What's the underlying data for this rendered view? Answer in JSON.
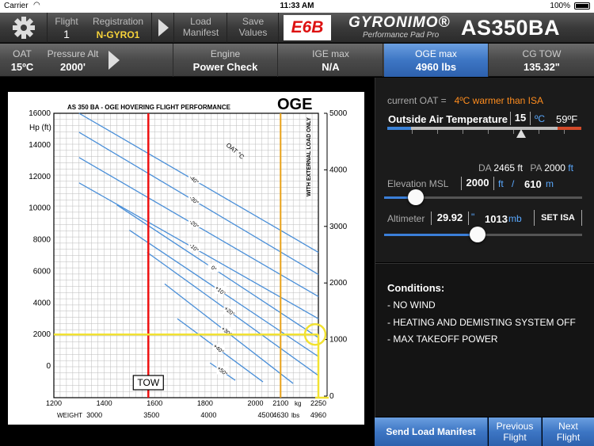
{
  "status": {
    "carrier": "Carrier",
    "time": "11:33 AM",
    "battery": "100%"
  },
  "toolbar": {
    "flight_label": "Flight",
    "flight_value": "1",
    "registration_label": "Registration",
    "registration_value": "N-GYRO1",
    "load_label_1": "Load",
    "load_label_2": "Manifest",
    "save_label_1": "Save",
    "save_label_2": "Values",
    "e6b": "E6B",
    "brand_name": "GYRONIMO®",
    "brand_sub": "Performance Pad Pro",
    "model": "AS350BA"
  },
  "bar2": {
    "oat_label": "OAT",
    "oat_value": "15ºC",
    "pa_label": "Pressure Alt",
    "pa_value": "2000'",
    "engine_label": "Engine",
    "engine_value": "Power Check",
    "ige_label": "IGE max",
    "ige_value": "N/A",
    "oge_label": "OGE max",
    "oge_value": "4960 lbs",
    "cg_label": "CG TOW",
    "cg_value": "135.32\""
  },
  "chart_data": {
    "type": "line",
    "title": "AS 350 BA - OGE HOVERING FLIGHT PERFORMANCE",
    "badge": "OGE",
    "ylabel": "Hp (ft)",
    "y_ticks": [
      "16000",
      "14000",
      "12000",
      "10000",
      "8000",
      "6000",
      "4000",
      "2000",
      "0"
    ],
    "ylim": [
      -2000,
      16000
    ],
    "right_ticks": [
      "5000",
      "4000",
      "3000",
      "2000",
      "1000",
      "0"
    ],
    "right_note": "WITH EXTERNAL LOAD ONLY",
    "x_ticks_kg": [
      "1200",
      "1400",
      "1600",
      "1800",
      "2000",
      "2100",
      "2250"
    ],
    "x_ticks_lbs": [
      "3000",
      "3500",
      "4000",
      "4500",
      "4630",
      "4960"
    ],
    "x_label_kg": "kg",
    "x_label_lbs": "lbs",
    "x_weight_label": "WEIGHT",
    "xlim_kg": [
      1200,
      2250
    ],
    "curve_header": "OAT °C",
    "oat_curves": [
      {
        "label": "-40°",
        "from": [
          1300,
          16000
        ],
        "to": [
          2250,
          7200
        ]
      },
      {
        "label": "-30°",
        "from": [
          1300,
          14800
        ],
        "to": [
          2250,
          5800
        ]
      },
      {
        "label": "-20°",
        "from": [
          1300,
          13200
        ],
        "to": [
          2250,
          4400
        ]
      },
      {
        "label": "-10°",
        "from": [
          1300,
          11600
        ],
        "to": [
          2250,
          3000
        ]
      },
      {
        "label": "0°",
        "from": [
          1450,
          10200
        ],
        "to": [
          2250,
          1800
        ]
      },
      {
        "label": "+10°",
        "from": [
          1500,
          8600
        ],
        "to": [
          2250,
          600
        ]
      },
      {
        "label": "+20°",
        "from": [
          1570,
          7200
        ],
        "to": [
          2250,
          -600
        ]
      },
      {
        "label": "+30°",
        "from": [
          1640,
          5200
        ],
        "to": [
          2150,
          -1100
        ]
      },
      {
        "label": "+40°",
        "from": [
          1690,
          3000
        ],
        "to": [
          2030,
          -1000
        ]
      },
      {
        "label": "+50°",
        "from": [
          1820,
          200
        ],
        "to": [
          1920,
          -900
        ]
      }
    ],
    "markers": {
      "pressure_altitude": 2000,
      "tow_kg": 1575,
      "max_kg": 2100,
      "result_kg": 2250,
      "tow_label": "TOW"
    }
  },
  "panel": {
    "current_oat_label": "current OAT =",
    "current_oat_value": "4ºC warmer than ISA",
    "oat_title": "Outside Air Temperature",
    "oat_c": "15",
    "unit_c": "ºC",
    "oat_f": "59ºF",
    "oat_fraction": 0.69,
    "da_label": "DA",
    "da_value": "2465 ft",
    "pa_label": "PA",
    "pa_value": "2000",
    "pa_unit": "ft",
    "elev_label": "Elevation MSL",
    "elev_ft": "2000",
    "elev_unit_ft": "ft",
    "elev_sep": "/",
    "elev_m": "610",
    "elev_unit_m": "m",
    "elev_fraction": 0.16,
    "alt_label": "Altimeter",
    "alt_value": "29.92",
    "alt_unit": "\"",
    "alt_mb": "1013",
    "alt_mb_unit": "mb",
    "alt_fraction": 0.47,
    "set_isa": "SET ISA",
    "conditions_title": "Conditions:",
    "conditions": [
      "- NO WIND",
      "- HEATING AND DEMISTING SYSTEM OFF",
      "- MAX TAKEOFF POWER"
    ]
  },
  "bottom": {
    "send": "Send Load Manifest",
    "prev_1": "Previous",
    "prev_2": "Flight",
    "next_1": "Next",
    "next_2": "Flight"
  }
}
